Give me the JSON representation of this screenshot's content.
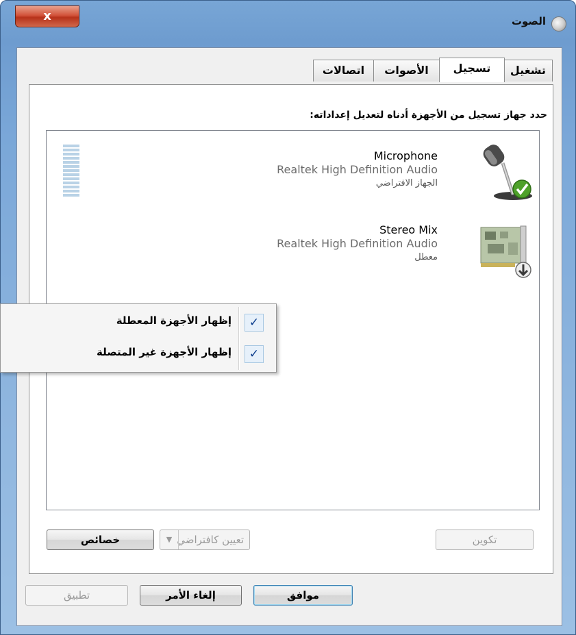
{
  "window": {
    "title": "الصوت",
    "close_label": "x",
    "icon": "speaker-icon"
  },
  "tabs": [
    {
      "label": "تشغيل",
      "active": false
    },
    {
      "label": "تسجيل",
      "active": true
    },
    {
      "label": "الأصوات",
      "active": false
    },
    {
      "label": "اتصالات",
      "active": false
    }
  ],
  "instruction": "حدد جهاز تسجيل من الأجهزة أدناه لتعديل إعداداته:",
  "devices": [
    {
      "name": "Microphone",
      "driver": "Realtek High Definition Audio",
      "status": "الجهاز الافتراضي",
      "icon": "microphone-icon",
      "badge": "default-check-icon",
      "level": 0.0
    },
    {
      "name": "Stereo Mix",
      "driver": "Realtek High Definition Audio",
      "status": "معطل",
      "icon": "sound-card-icon",
      "badge": "disabled-down-arrow-icon"
    }
  ],
  "context_menu": {
    "items": [
      {
        "label": "إظهار الأجهزة المعطلة",
        "checked": true,
        "check": "✓"
      },
      {
        "label": "إظهار الأجهزة غير المتصلة",
        "checked": true,
        "check": "✓"
      }
    ]
  },
  "buttons": {
    "configure": "تكوين",
    "set_default": "تعيين كافتراضي",
    "set_default_arrow": "▼",
    "properties": "خصائص",
    "ok": "موافق",
    "cancel": "إلغاء الأمر",
    "apply": "تطبيق"
  },
  "colors": {
    "accent": "#4ea12a",
    "meter": "#b9d2e6",
    "frame": "#78a6d6",
    "close": "#c7472e"
  }
}
